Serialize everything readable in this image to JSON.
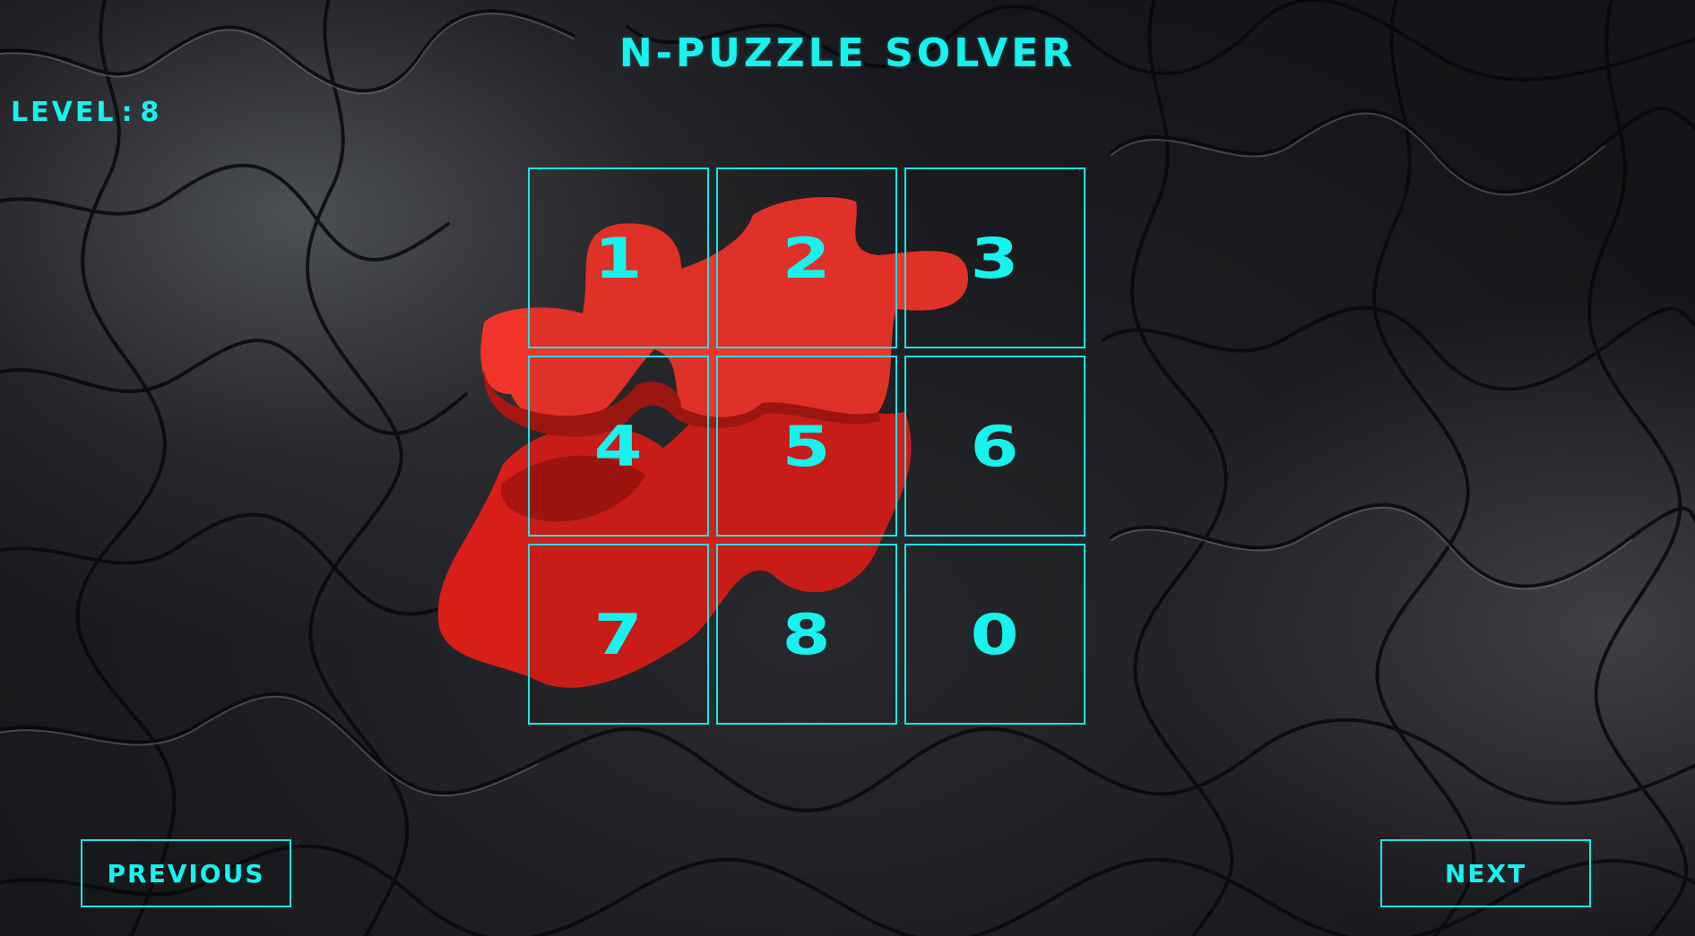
{
  "title": "N-PUZZLE SOLVER",
  "level": {
    "label": "LEVEL",
    "separator": ":",
    "value": "8"
  },
  "board": {
    "rows": 3,
    "cols": 3,
    "tiles": [
      "1",
      "2",
      "3",
      "4",
      "5",
      "6",
      "7",
      "8",
      "0"
    ]
  },
  "buttons": {
    "previous": "PREVIOUS",
    "next": "NEXT"
  },
  "colors": {
    "accent": "#18f2ee",
    "background_dark": "#1c1d20",
    "puzzle_piece_red": "#e8231d"
  },
  "background_image": "jigsaw-puzzle-pieces-with-red-piece"
}
